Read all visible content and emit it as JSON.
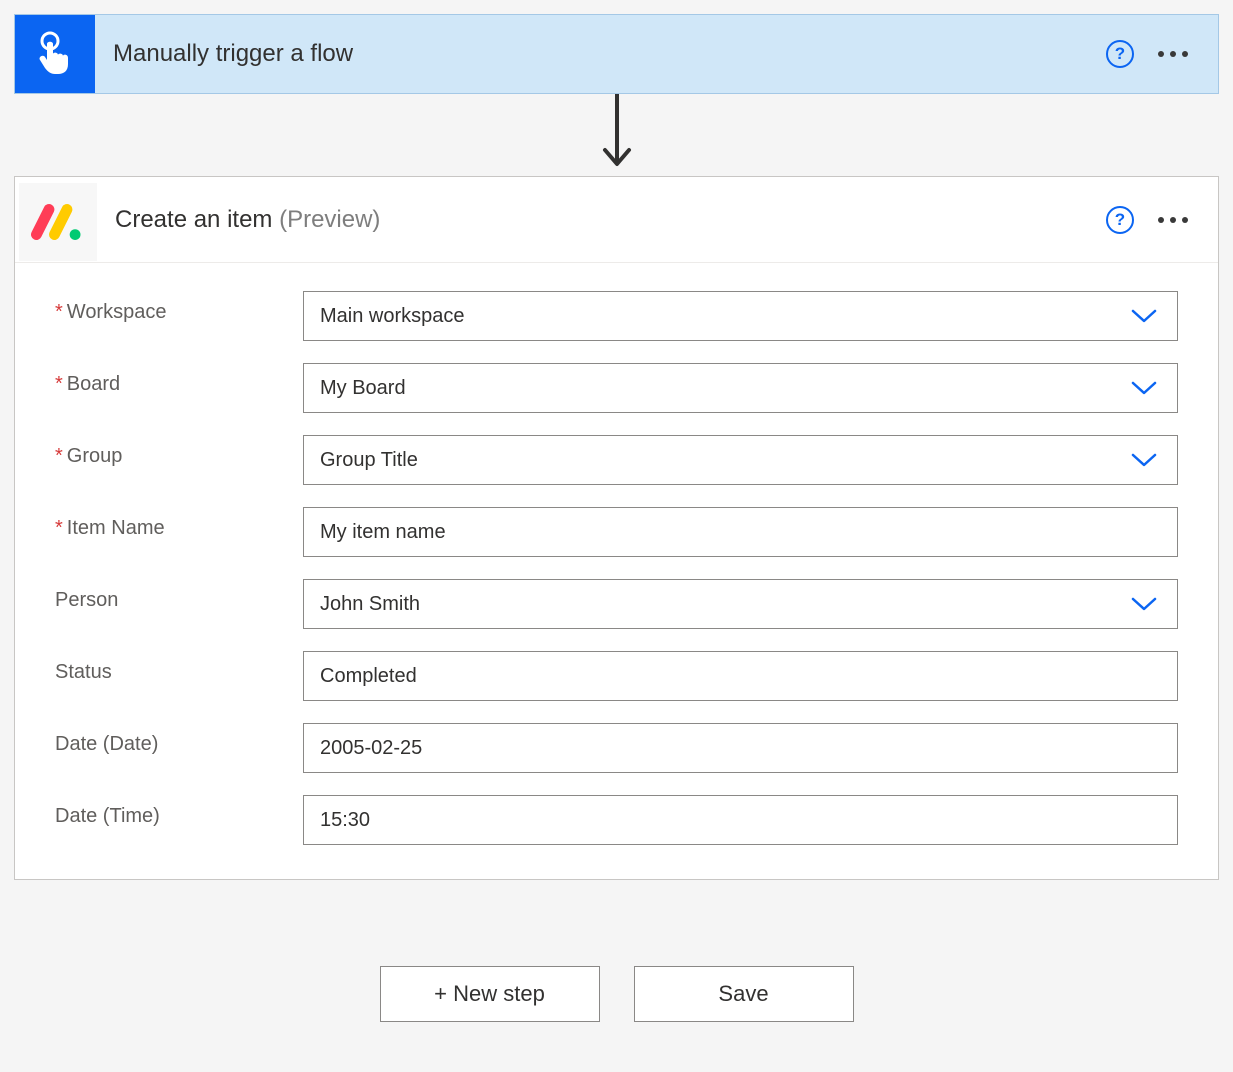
{
  "trigger": {
    "title": "Manually trigger a flow",
    "icon_name": "manual-trigger-icon",
    "help_char": "?"
  },
  "action": {
    "title": "Create an item",
    "preview_label": "(Preview)",
    "icon_name": "monday-icon",
    "help_char": "?",
    "fields": [
      {
        "key": "workspace",
        "label": "Workspace",
        "required": true,
        "value": "Main workspace",
        "type": "select"
      },
      {
        "key": "board",
        "label": "Board",
        "required": true,
        "value": "My Board",
        "type": "select"
      },
      {
        "key": "group",
        "label": "Group",
        "required": true,
        "value": "Group Title",
        "type": "select"
      },
      {
        "key": "item_name",
        "label": "Item Name",
        "required": true,
        "value": "My item name",
        "type": "text"
      },
      {
        "key": "person",
        "label": "Person",
        "required": false,
        "value": "John Smith",
        "type": "select"
      },
      {
        "key": "status",
        "label": "Status",
        "required": false,
        "value": "Completed",
        "type": "text"
      },
      {
        "key": "date_date",
        "label": "Date (Date)",
        "required": false,
        "value": "2005-02-25",
        "type": "text"
      },
      {
        "key": "date_time",
        "label": "Date (Time)",
        "required": false,
        "value": "15:30",
        "type": "text"
      }
    ]
  },
  "footer": {
    "new_step_label": "+ New step",
    "save_label": "Save"
  },
  "colors": {
    "accent": "#0b65f2",
    "trigger_bg": "#d0e7f8",
    "border": "#8a8886"
  }
}
